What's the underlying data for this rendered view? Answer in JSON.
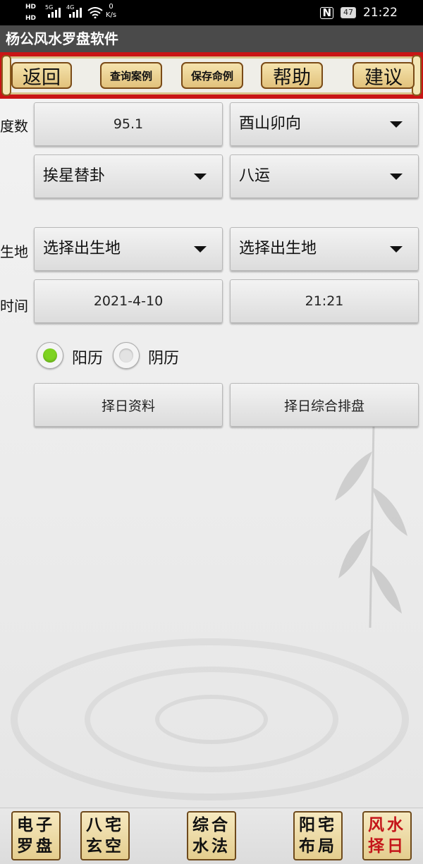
{
  "status_bar": {
    "hd1": "HD",
    "hd2": "HD",
    "net1": "5G",
    "net2": "4G",
    "speed_value": "0",
    "speed_unit": "K/s",
    "battery": "47",
    "time": "21:22"
  },
  "app_title": "杨公风水罗盘软件",
  "toolbar": {
    "back": "返回",
    "query_cases": "查询案例",
    "save_case": "保存命例",
    "help": "帮助",
    "suggest": "建议"
  },
  "form": {
    "degree_label": "度数",
    "degree_value": "95.1",
    "direction_selected": "酉山卯向",
    "method_selected": "挨星替卦",
    "period_selected": "八运",
    "birthplace_label": "生地",
    "birthplace_1": "选择出生地",
    "birthplace_2": "选择出生地",
    "time_label": "时间",
    "date_value": "2021-4-10",
    "time_value": "21:21",
    "radio_solar": "阳历",
    "radio_lunar": "阴历",
    "calendar_selected": "阳历",
    "btn_date_info": "择日资料",
    "btn_comprehensive": "择日综合排盘"
  },
  "bottom_nav": [
    {
      "line1": "电子",
      "line2": "罗盘"
    },
    {
      "line1": "八宅",
      "line2": "玄空"
    },
    {
      "line1": "综合",
      "line2": "水法"
    },
    {
      "line1": "阳宅",
      "line2": "布局"
    },
    {
      "line1": "风水",
      "line2": "择日"
    }
  ],
  "colors": {
    "toolbar_red": "#c91515",
    "radio_selected": "#7ed321",
    "active_nav_text": "#c4151a"
  }
}
